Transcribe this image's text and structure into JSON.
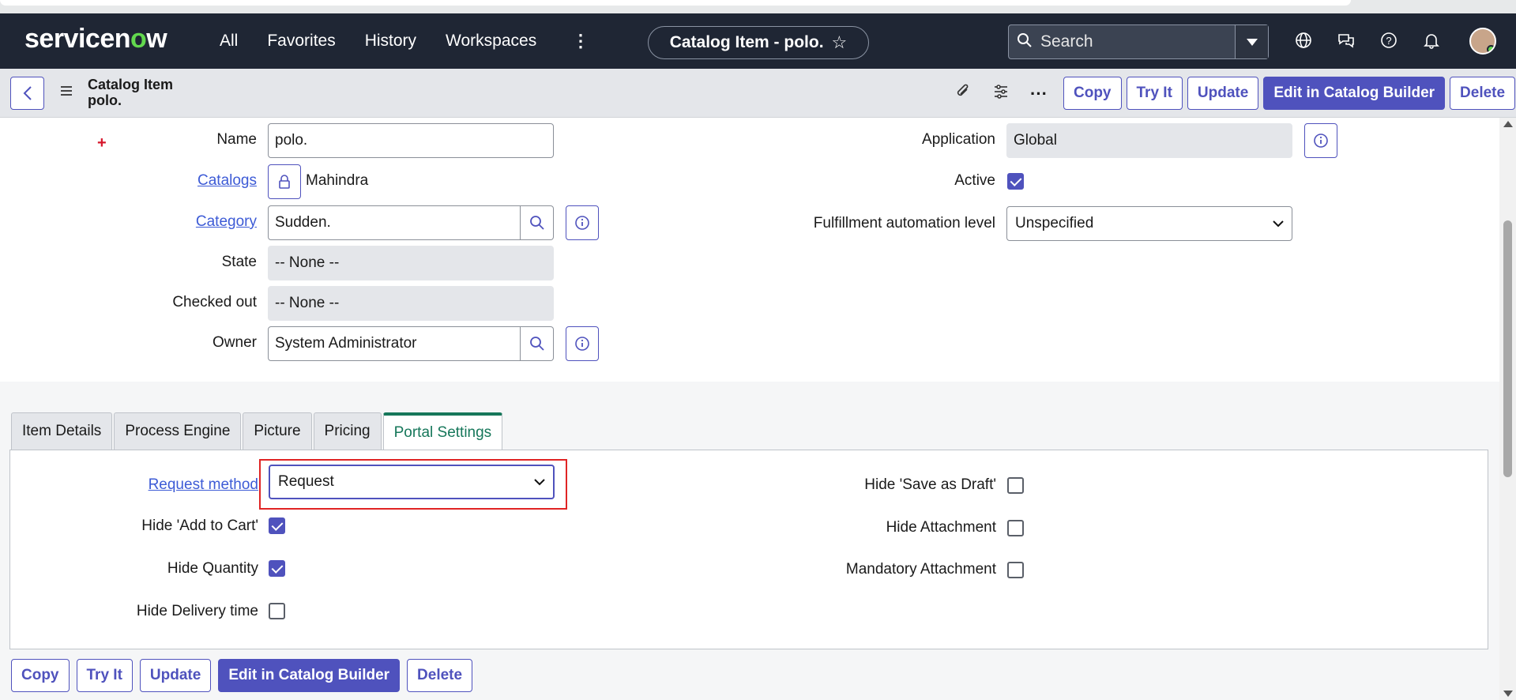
{
  "nav": {
    "logo_prefix": "servicen",
    "logo_o": "o",
    "logo_suffix": "w",
    "links": [
      "All",
      "Favorites",
      "History",
      "Workspaces"
    ],
    "context_title": "Catalog Item - polo.",
    "search_placeholder": "Search"
  },
  "header": {
    "title_line1": "Catalog Item",
    "title_line2": "polo.",
    "buttons": {
      "copy": "Copy",
      "try_it": "Try It",
      "update": "Update",
      "edit_catalog_builder": "Edit in Catalog Builder",
      "delete": "Delete"
    }
  },
  "form": {
    "name_label": "Name",
    "name_value": "polo.",
    "catalogs_label": "Catalogs",
    "catalogs_value": "Mahindra",
    "category_label": "Category",
    "category_value": "Sudden.",
    "state_label": "State",
    "state_value": "-- None --",
    "checked_out_label": "Checked out",
    "checked_out_value": "-- None --",
    "owner_label": "Owner",
    "owner_value": "System Administrator",
    "application_label": "Application",
    "application_value": "Global",
    "active_label": "Active",
    "active_checked": true,
    "fulfillment_label": "Fulfillment automation level",
    "fulfillment_value": "Unspecified"
  },
  "tabs": [
    "Item Details",
    "Process Engine",
    "Picture",
    "Pricing",
    "Portal Settings"
  ],
  "active_tab": "Portal Settings",
  "portal": {
    "request_method_label": "Request method",
    "request_method_value": "Request",
    "hide_add_to_cart_label": "Hide 'Add to Cart'",
    "hide_add_to_cart": true,
    "hide_quantity_label": "Hide Quantity",
    "hide_quantity": true,
    "hide_delivery_label": "Hide Delivery time",
    "hide_delivery": false,
    "hide_save_draft_label": "Hide 'Save as Draft'",
    "hide_save_draft": false,
    "hide_attachment_label": "Hide Attachment",
    "hide_attachment": false,
    "mandatory_attachment_label": "Mandatory Attachment",
    "mandatory_attachment": false
  },
  "footer_buttons": {
    "copy": "Copy",
    "try_it": "Try It",
    "update": "Update",
    "edit_catalog_builder": "Edit in Catalog Builder",
    "delete": "Delete"
  },
  "colors": {
    "nav_bg": "#1f2634",
    "accent": "#4f52bd",
    "tab_active": "#16775a",
    "highlight": "#e02424"
  }
}
